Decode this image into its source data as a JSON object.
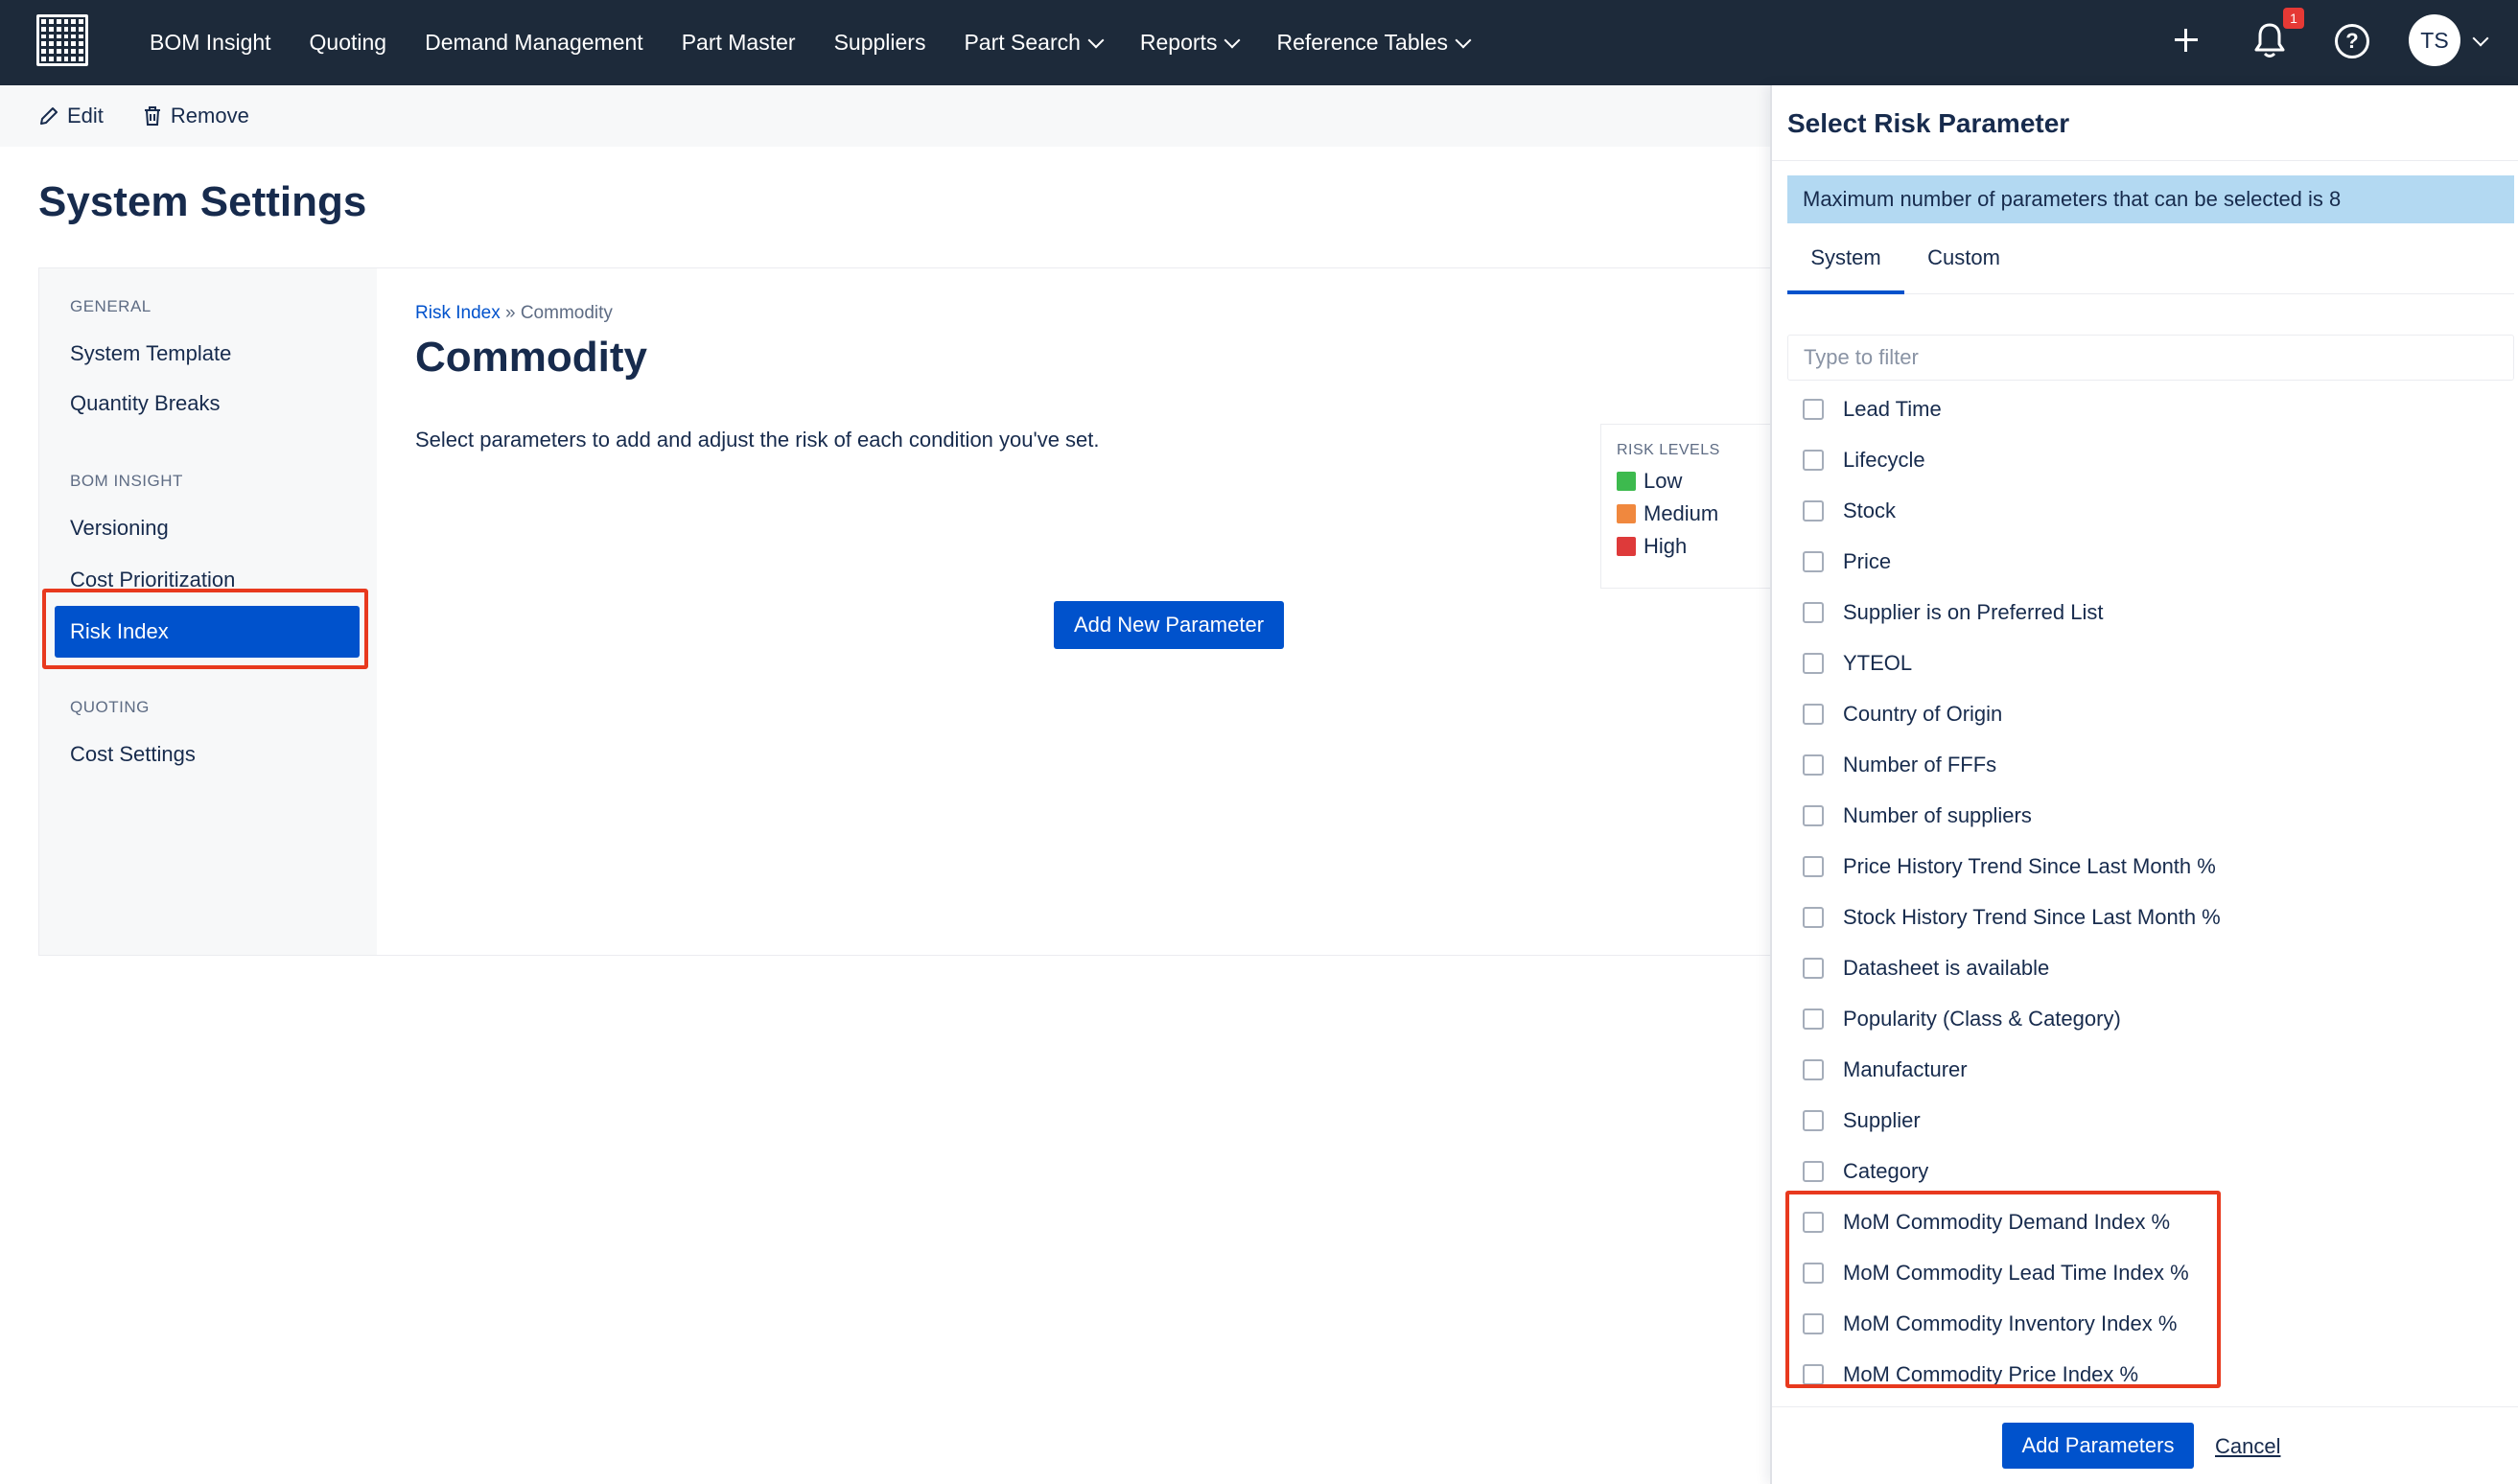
{
  "nav": {
    "items": [
      {
        "label": "BOM Insight",
        "dropdown": false
      },
      {
        "label": "Quoting",
        "dropdown": false
      },
      {
        "label": "Demand Management",
        "dropdown": false
      },
      {
        "label": "Part Master",
        "dropdown": false
      },
      {
        "label": "Suppliers",
        "dropdown": false
      },
      {
        "label": "Part Search",
        "dropdown": true
      },
      {
        "label": "Reports",
        "dropdown": true
      },
      {
        "label": "Reference Tables",
        "dropdown": true
      }
    ],
    "notification_count": "1",
    "avatar_initials": "TS"
  },
  "toolbar": {
    "edit_label": "Edit",
    "remove_label": "Remove"
  },
  "page": {
    "title": "System Settings"
  },
  "sidebar": {
    "general_heading": "GENERAL",
    "system_template": "System Template",
    "quantity_breaks": "Quantity Breaks",
    "bom_heading": "BOM INSIGHT",
    "versioning": "Versioning",
    "cost_prioritization": "Cost Prioritization",
    "risk_index": "Risk Index",
    "quoting_heading": "QUOTING",
    "cost_settings": "Cost Settings"
  },
  "main": {
    "breadcrumb_link": "Risk Index",
    "breadcrumb_sep": " » ",
    "breadcrumb_current": "Commodity",
    "title": "Commodity",
    "description": "Select parameters to add and adjust the risk of each condition you've set.",
    "add_button": "Add New Parameter",
    "risk_levels": {
      "heading": "RISK LEVELS",
      "low": "Low",
      "medium": "Medium",
      "high": "High",
      "low_color": "#3dba4e",
      "medium_color": "#f0883e",
      "high_color": "#de3a3a"
    }
  },
  "panel": {
    "title": "Select Risk Parameter",
    "banner": "Maximum number of parameters that can be selected is 8",
    "tab_system": "System",
    "tab_custom": "Custom",
    "filter_placeholder": "Type to filter",
    "params": [
      "Lead Time",
      "Lifecycle",
      "Stock",
      "Price",
      "Supplier is on Preferred List",
      "YTEOL",
      "Country of Origin",
      "Number of FFFs",
      "Number of suppliers",
      "Price History Trend Since Last Month %",
      "Stock History Trend Since Last Month %",
      "Datasheet is available",
      "Popularity (Class & Category)",
      "Manufacturer",
      "Supplier",
      "Category",
      "MoM Commodity Demand Index %",
      "MoM Commodity Lead Time Index %",
      "MoM Commodity Inventory Index %",
      "MoM Commodity Price Index %"
    ],
    "add_button": "Add Parameters",
    "cancel": "Cancel"
  }
}
